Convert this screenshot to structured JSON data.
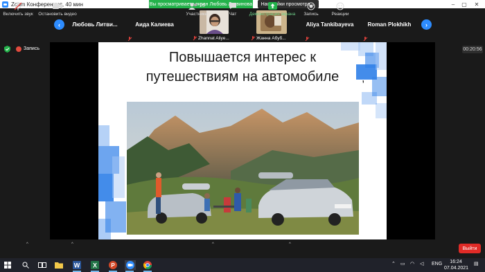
{
  "window": {
    "title": "Zoom Конференция, 40 мин"
  },
  "banner": {
    "viewing_text": "Вы просматриваете экран Любовь Литвинова",
    "view_options_label": "Настройки просмотра",
    "view_options_caret": "⌄"
  },
  "window_controls": {
    "minimize": "–",
    "restore": "▢",
    "close": "✕"
  },
  "strip": {
    "prev_arrow": "‹",
    "next_arrow": "›",
    "participants": [
      {
        "name": "Любовь   Литви...",
        "type": "name"
      },
      {
        "name": "Аида Калиева",
        "type": "name"
      },
      {
        "name": "Zhannat Aliye...",
        "type": "video"
      },
      {
        "name": "Жанна Абуб...",
        "type": "video"
      },
      {
        "name": "Aliya Tankibayeva",
        "type": "name"
      },
      {
        "name": "Roman Plokhikh",
        "type": "name"
      }
    ]
  },
  "status": {
    "recording_label": "Запись",
    "timer": "00:20:56"
  },
  "slide": {
    "title_line1": "Повышается интерес к",
    "title_line2": "путешествиям на автомобиле",
    "comma": ","
  },
  "toolbar": {
    "audio_label": "Включить звук",
    "video_label": "Остановить видео",
    "participants_label": "Участники",
    "participants_count": "26",
    "chat_label": "Чат",
    "share_label": "Демонстрация экрана",
    "record_label": "Запись",
    "reactions_label": "Реакции",
    "end_label": "Выйти",
    "caret": "^"
  },
  "taskbar": {
    "language": "ENG",
    "time": "16:24",
    "date": "07.04.2021"
  },
  "colors": {
    "zoom_blue": "#2d8cff",
    "banner_green": "#24b24b",
    "end_red": "#e02b27"
  }
}
